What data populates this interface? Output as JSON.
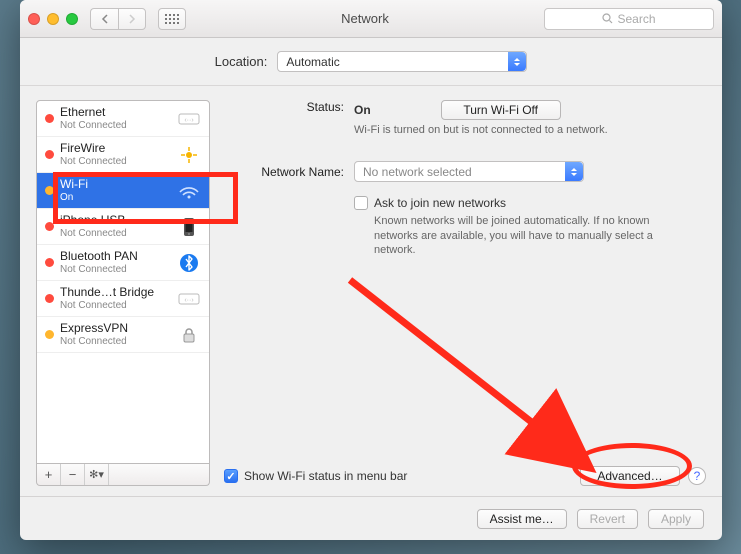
{
  "window": {
    "title": "Network",
    "search_placeholder": "Search"
  },
  "location": {
    "label": "Location:",
    "value": "Automatic"
  },
  "sidebar": {
    "items": [
      {
        "name": "Ethernet",
        "sub": "Not Connected",
        "dot": "#ff4b3e"
      },
      {
        "name": "FireWire",
        "sub": "Not Connected",
        "dot": "#ff4b3e"
      },
      {
        "name": "Wi-Fi",
        "sub": "On",
        "dot": "#ffb62e"
      },
      {
        "name": "iPhone USB",
        "sub": "Not Connected",
        "dot": "#ff4b3e"
      },
      {
        "name": "Bluetooth PAN",
        "sub": "Not Connected",
        "dot": "#ff4b3e"
      },
      {
        "name": "Thunde…t Bridge",
        "sub": "Not Connected",
        "dot": "#ff4b3e"
      },
      {
        "name": "ExpressVPN",
        "sub": "Not Connected",
        "dot": "#ffb62e"
      }
    ]
  },
  "detail": {
    "status_label": "Status:",
    "status_value": "On",
    "status_hint": "Wi-Fi is turned on but is not connected to a network.",
    "wifi_toggle": "Turn Wi-Fi Off",
    "netname_label": "Network Name:",
    "netname_value": "No network selected",
    "ask_label": "Ask to join new networks",
    "ask_hint": "Known networks will be joined automatically. If no known networks are available, you will have to manually select a network.",
    "show_status": "Show Wi-Fi status in menu bar",
    "advanced": "Advanced…"
  },
  "footer": {
    "assist": "Assist me…",
    "revert": "Revert",
    "apply": "Apply"
  }
}
